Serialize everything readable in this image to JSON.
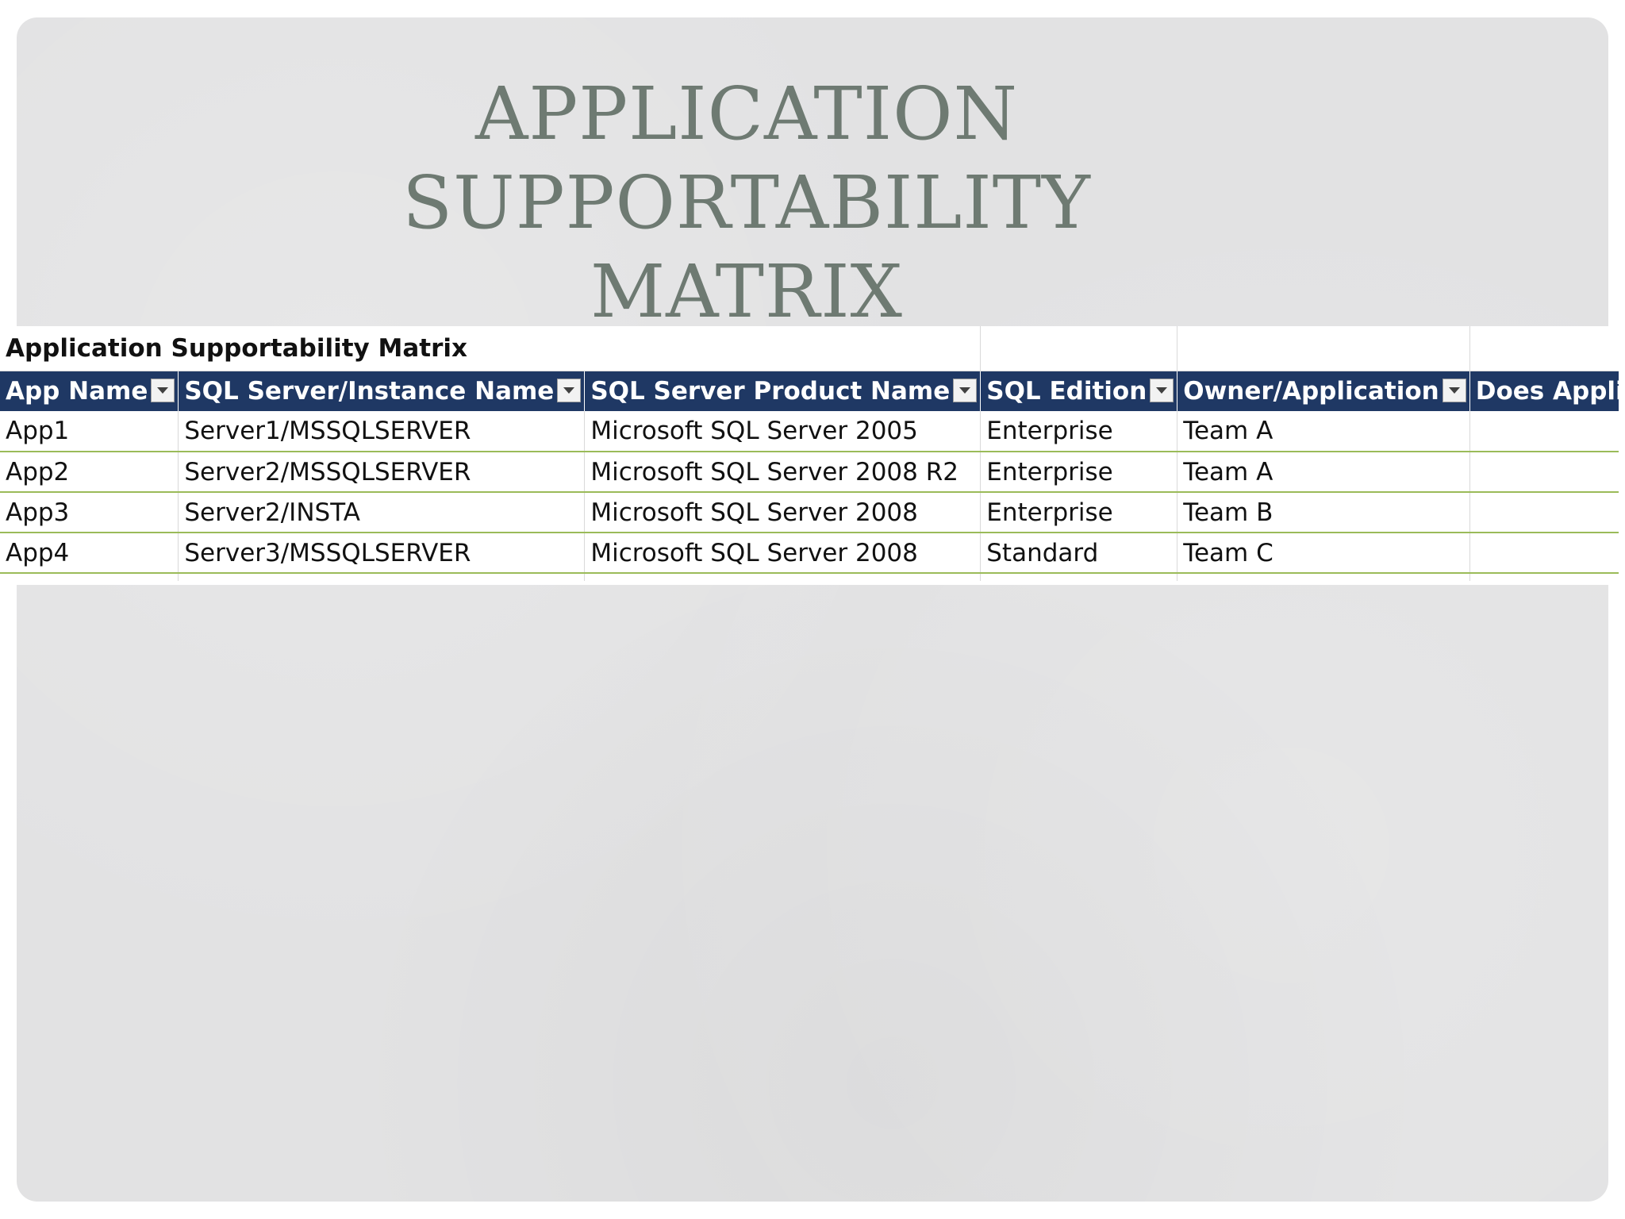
{
  "slide": {
    "title_line1": "APPLICATION SUPPORTABILITY",
    "title_line2": "MATRIX"
  },
  "sheet": {
    "caption": "Application Supportability Matrix",
    "columns": [
      "App Name",
      "SQL Server/Instance Name",
      "SQL Server Product Name",
      "SQL Edition",
      "Owner/Application",
      "Does Applica"
    ],
    "rows": [
      [
        "App1",
        "Server1/MSSQLSERVER",
        "Microsoft SQL Server 2005",
        "Enterprise",
        "Team A",
        ""
      ],
      [
        "App2",
        "Server2/MSSQLSERVER",
        "Microsoft SQL Server 2008 R2",
        "Enterprise",
        "Team A",
        ""
      ],
      [
        "App3",
        "Server2/INSTA",
        "Microsoft SQL Server 2008",
        "Enterprise",
        "Team B",
        ""
      ],
      [
        "App4",
        "Server3/MSSQLSERVER",
        "Microsoft SQL Server 2008",
        "Standard",
        "Team C",
        ""
      ]
    ]
  },
  "colors": {
    "title": "#6e7a72",
    "header_bg": "#1f3864",
    "row_border": "#9bbb59",
    "slide_bg": "#e2e2e3"
  }
}
